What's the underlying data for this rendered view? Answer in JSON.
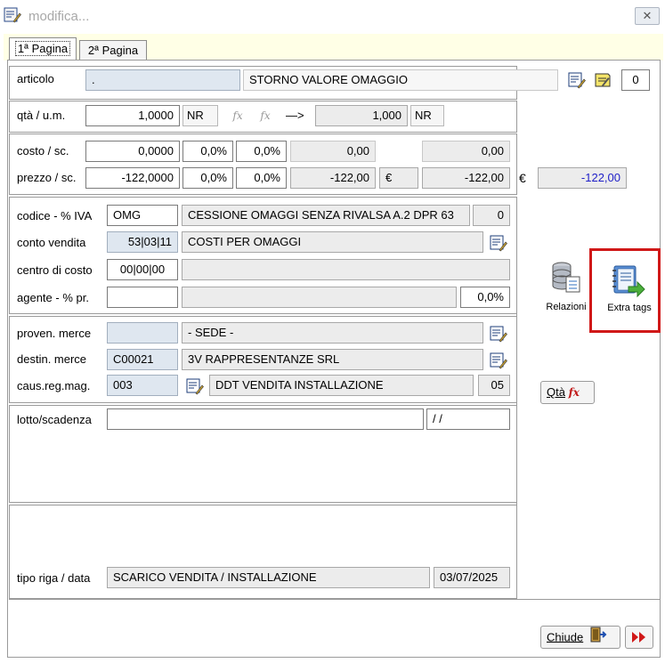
{
  "window": {
    "title": "modifica...",
    "close_label": "✕"
  },
  "tabs": [
    {
      "label": "1ª Pagina"
    },
    {
      "label": "2ª Pagina"
    }
  ],
  "articolo": {
    "label": "articolo",
    "code": ".",
    "description": "STORNO VALORE OMAGGIO",
    "count": "0"
  },
  "quantity": {
    "label": "qtà / u.m.",
    "value": "1,0000",
    "unit": "NR",
    "fx1": "fx",
    "fx2": "fx",
    "arrow": "—>",
    "converted_value": "1,000",
    "converted_unit": "NR"
  },
  "costo": {
    "label": "costo / sc.",
    "value": "0,0000",
    "disc1": "0,0%",
    "disc2": "0,0%",
    "total": "0,00",
    "total2": "0,00"
  },
  "prezzo": {
    "label": "prezzo / sc.",
    "value": "-122,0000",
    "disc1": "0,0%",
    "disc2": "0,0%",
    "total": "-122,00",
    "currency1": "€",
    "total2": "-122,00",
    "currency2": "€",
    "total3": "-122,00"
  },
  "iva": {
    "label": "codice - % IVA",
    "code": "OMG",
    "description": "CESSIONE OMAGGI SENZA RIVALSA A.2 DPR 63",
    "percent": "0"
  },
  "conto_vendita": {
    "label": "conto vendita",
    "code": "53|03|11",
    "description": "COSTI PER OMAGGI"
  },
  "centro_costo": {
    "label": "centro di costo",
    "code": "00|00|00",
    "description": ""
  },
  "agente": {
    "label": "agente - % pr.",
    "code": "",
    "description": "",
    "percent": "0,0%"
  },
  "proven_merce": {
    "label": "proven. merce",
    "code": "",
    "description": "- SEDE -"
  },
  "destin_merce": {
    "label": "destin. merce",
    "code": "C00021",
    "description": "3V RAPPRESENTANZE SRL"
  },
  "caus_reg_mag": {
    "label": "caus.reg.mag.",
    "code": "003",
    "description": "DDT VENDITA INSTALLAZIONE",
    "num": "05"
  },
  "lotto": {
    "label": "lotto/scadenza",
    "value": "",
    "date": "/ /"
  },
  "tipo_riga": {
    "label": "tipo riga / data",
    "value": "SCARICO VENDITA / INSTALLAZIONE",
    "date": "03/07/2025"
  },
  "side_panel": {
    "relazioni_label": "Relazioni",
    "extra_tags_label": "Extra tags",
    "qta_button_label": "Qtà",
    "qta_fx": "fx"
  },
  "footer": {
    "chiude_label": "Chiude"
  },
  "colors": {
    "highlight": "#d01818",
    "tab_strip": "#ffffe6",
    "blue_field": "#dfe7f0",
    "negative_text": "#2020c8"
  }
}
